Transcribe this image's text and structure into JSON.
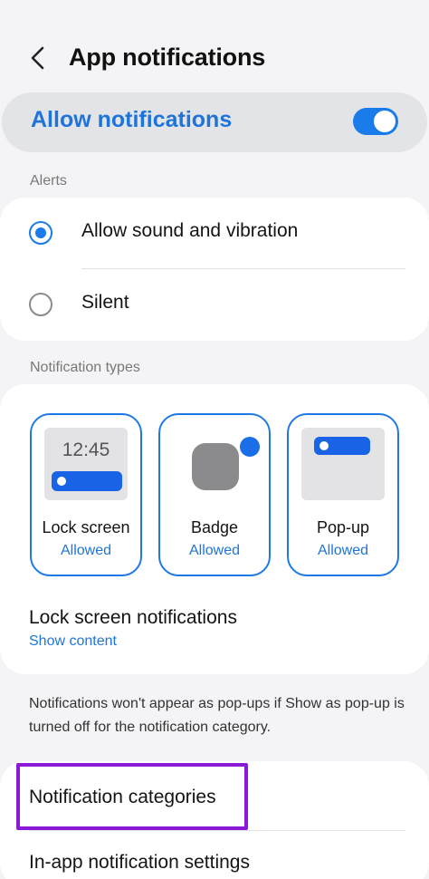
{
  "header": {
    "title": "App notifications"
  },
  "allow": {
    "label": "Allow notifications",
    "enabled": true
  },
  "alerts": {
    "section_label": "Alerts",
    "options": [
      {
        "label": "Allow sound and vibration",
        "selected": true
      },
      {
        "label": "Silent",
        "selected": false
      }
    ]
  },
  "types": {
    "section_label": "Notification types",
    "items": [
      {
        "label": "Lock screen",
        "status": "Allowed",
        "preview_time": "12:45"
      },
      {
        "label": "Badge",
        "status": "Allowed"
      },
      {
        "label": "Pop-up",
        "status": "Allowed"
      }
    ],
    "lock_screen_row": {
      "title": "Lock screen notifications",
      "value": "Show content"
    }
  },
  "info": {
    "text": "Notifications won't appear as pop-ups if Show as pop-up is turned off for the notification category."
  },
  "categories": {
    "label": "Notification categories",
    "in_app_label": "In-app notification settings"
  },
  "colors": {
    "accent": "#1a7bea",
    "accent_text": "#1f74d9",
    "highlight": "#8a1ad6",
    "background": "#f4f4f6"
  }
}
